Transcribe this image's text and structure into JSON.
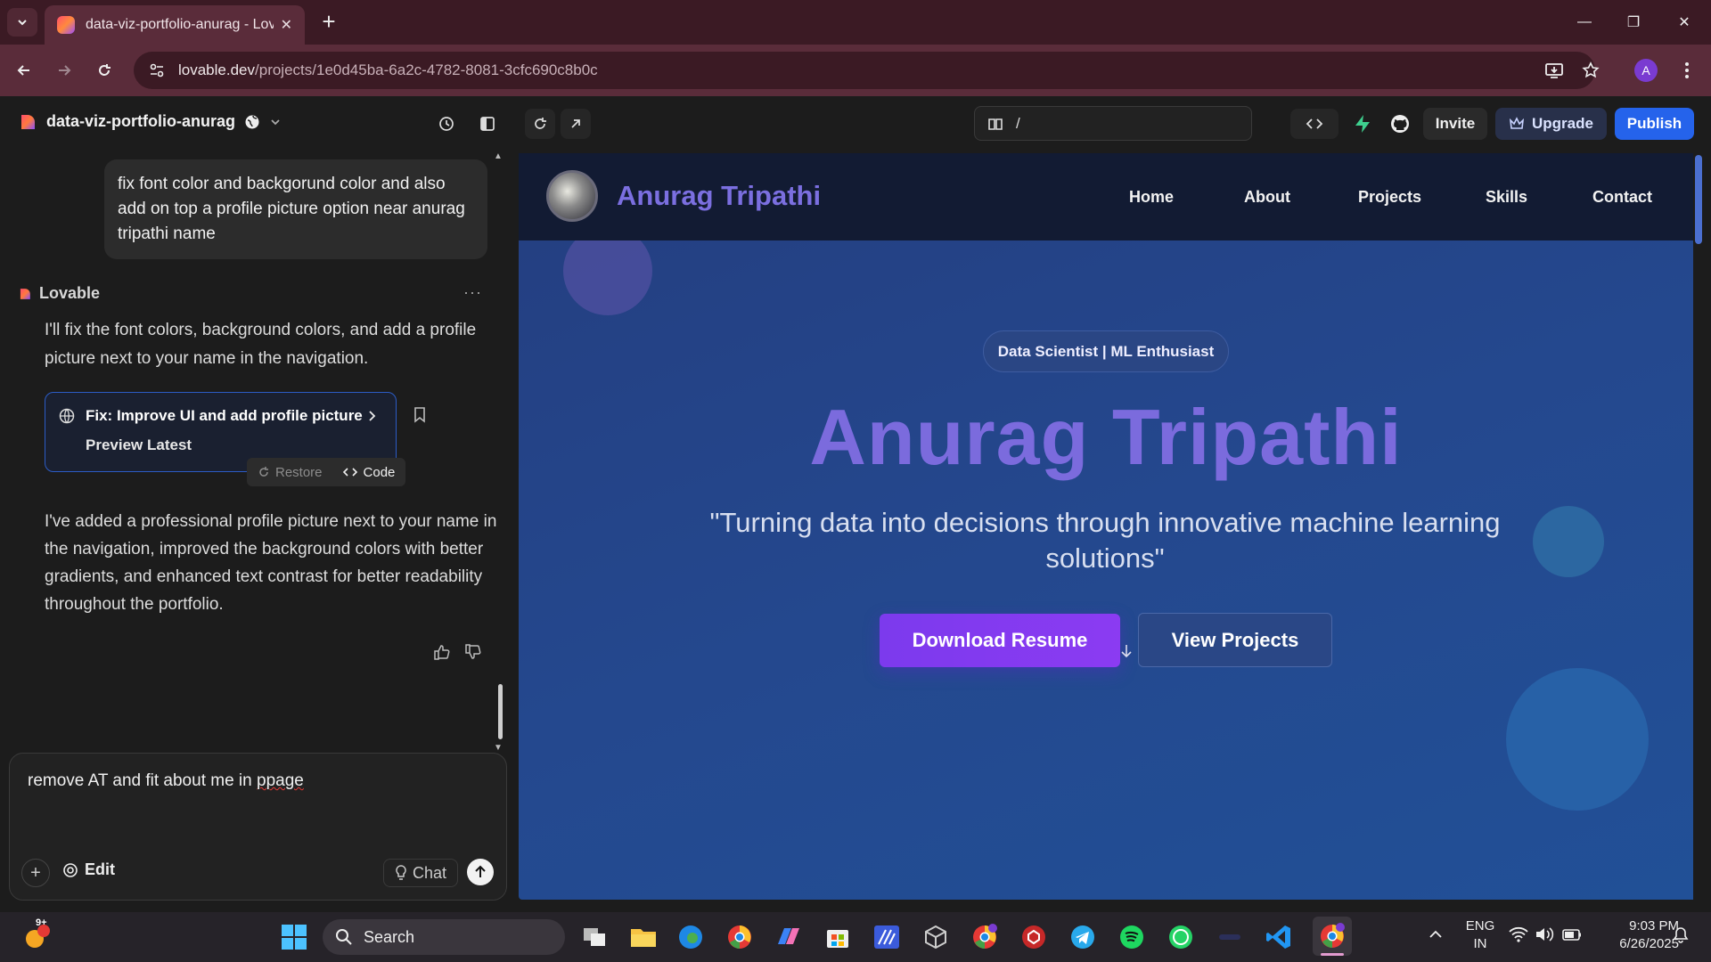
{
  "browser": {
    "tab_title": "data-viz-portfolio-anurag - Lov",
    "url_host": "lovable.dev",
    "url_path": "/projects/1e0d45ba-6a2c-4782-8081-3cfc690c8b0c",
    "profile_initial": "A"
  },
  "topbar": {
    "project_name": "data-viz-portfolio-anurag",
    "path_value": "/",
    "invite_label": "Invite",
    "upgrade_label": "Upgrade",
    "publish_label": "Publish"
  },
  "chat": {
    "user_message": "fix font color and backgorund color and also add on top a profile picture option near anurag tripathi name",
    "assistant_name": "Lovable",
    "assistant_intro": "I'll fix the font colors, background colors, and add a profile picture next to your name in the navigation.",
    "card_title": "Fix: Improve UI and add profile picture",
    "card_subtitle": "Preview Latest",
    "restore_label": "Restore",
    "code_label": "Code",
    "assistant_summary": "I've added a professional profile picture next to your name in the navigation, improved the background colors with better gradients, and enhanced text contrast for better readability throughout the portfolio.",
    "input_prefix": "remove AT and fit about me in ",
    "input_misspelled": "ppage",
    "edit_label": "Edit",
    "chat_label": "Chat"
  },
  "preview": {
    "site_name": "Anurag Tripathi",
    "nav": [
      "Home",
      "About",
      "Projects",
      "Skills",
      "Contact"
    ],
    "badge": "Data Scientist | ML Enthusiast",
    "hero_title": "Anurag Tripathi",
    "tagline": "\"Turning data into decisions through innovative machine learning solutions\"",
    "download_label": "Download Resume",
    "view_projects_label": "View Projects",
    "accent_color": "#7b6bdd",
    "button_color": "#7c3aed"
  },
  "taskbar": {
    "search_label": "Search",
    "notification_badge": "9+",
    "lang_line1": "ENG",
    "lang_line2": "IN",
    "time": "9:03 PM",
    "date": "6/26/2025"
  }
}
